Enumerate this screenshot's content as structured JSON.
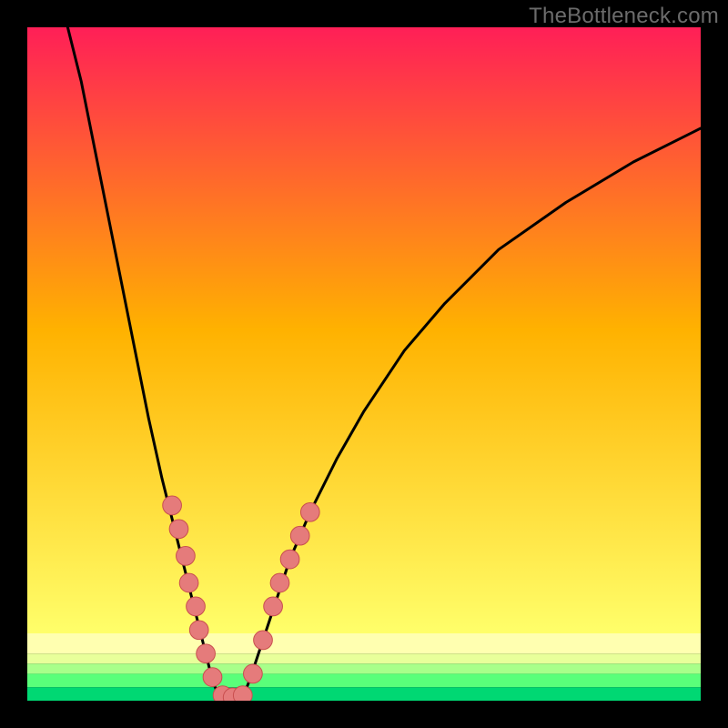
{
  "watermark": "TheBottleneck.com",
  "chart_data": {
    "type": "line",
    "title": "",
    "xlabel": "",
    "ylabel": "",
    "xlim": [
      0,
      100
    ],
    "ylim": [
      0,
      100
    ],
    "curve": {
      "name": "bottleneck-curve",
      "points": [
        {
          "x": 6,
          "y": 100
        },
        {
          "x": 8,
          "y": 92
        },
        {
          "x": 10,
          "y": 82
        },
        {
          "x": 12,
          "y": 72
        },
        {
          "x": 14,
          "y": 62
        },
        {
          "x": 16,
          "y": 52
        },
        {
          "x": 18,
          "y": 42
        },
        {
          "x": 20,
          "y": 33
        },
        {
          "x": 22,
          "y": 25
        },
        {
          "x": 24,
          "y": 17
        },
        {
          "x": 26,
          "y": 9
        },
        {
          "x": 27.5,
          "y": 3
        },
        {
          "x": 28.5,
          "y": 0.5
        },
        {
          "x": 30,
          "y": 0
        },
        {
          "x": 31,
          "y": 0
        },
        {
          "x": 32,
          "y": 0.5
        },
        {
          "x": 33,
          "y": 3
        },
        {
          "x": 35,
          "y": 9
        },
        {
          "x": 37,
          "y": 15
        },
        {
          "x": 39,
          "y": 21
        },
        {
          "x": 42,
          "y": 28
        },
        {
          "x": 46,
          "y": 36
        },
        {
          "x": 50,
          "y": 43
        },
        {
          "x": 56,
          "y": 52
        },
        {
          "x": 62,
          "y": 59
        },
        {
          "x": 70,
          "y": 67
        },
        {
          "x": 80,
          "y": 74
        },
        {
          "x": 90,
          "y": 80
        },
        {
          "x": 100,
          "y": 85
        }
      ]
    },
    "markers": {
      "name": "sample-points",
      "color": "#e57b7b",
      "outline": "#c94f4f",
      "radius_pct": 1.4,
      "points": [
        {
          "x": 21.5,
          "y": 29
        },
        {
          "x": 22.5,
          "y": 25.5
        },
        {
          "x": 23.5,
          "y": 21.5
        },
        {
          "x": 24,
          "y": 17.5
        },
        {
          "x": 25,
          "y": 14
        },
        {
          "x": 25.5,
          "y": 10.5
        },
        {
          "x": 26.5,
          "y": 7
        },
        {
          "x": 27.5,
          "y": 3.5
        },
        {
          "x": 29,
          "y": 0.8
        },
        {
          "x": 30.5,
          "y": 0.5
        },
        {
          "x": 32,
          "y": 0.8
        },
        {
          "x": 33.5,
          "y": 4
        },
        {
          "x": 35,
          "y": 9
        },
        {
          "x": 36.5,
          "y": 14
        },
        {
          "x": 37.5,
          "y": 17.5
        },
        {
          "x": 39,
          "y": 21
        },
        {
          "x": 40.5,
          "y": 24.5
        },
        {
          "x": 42,
          "y": 28
        }
      ]
    },
    "gradient_bands": [
      {
        "y_from": 100,
        "y_to": 10,
        "type": "linear",
        "stops": [
          {
            "offset": 0,
            "color": "#ff1f57"
          },
          {
            "offset": 0.5,
            "color": "#ffb200"
          },
          {
            "offset": 1,
            "color": "#ffff6a"
          }
        ]
      },
      {
        "y_from": 10,
        "y_to": 7,
        "color": "#ffffb0"
      },
      {
        "y_from": 7,
        "y_to": 5.5,
        "color": "#e8ff9a"
      },
      {
        "y_from": 5.5,
        "y_to": 4,
        "color": "#a8ff8a"
      },
      {
        "y_from": 4,
        "y_to": 2,
        "color": "#5aff7a"
      },
      {
        "y_from": 2,
        "y_to": 0,
        "color": "#00d873"
      }
    ]
  }
}
